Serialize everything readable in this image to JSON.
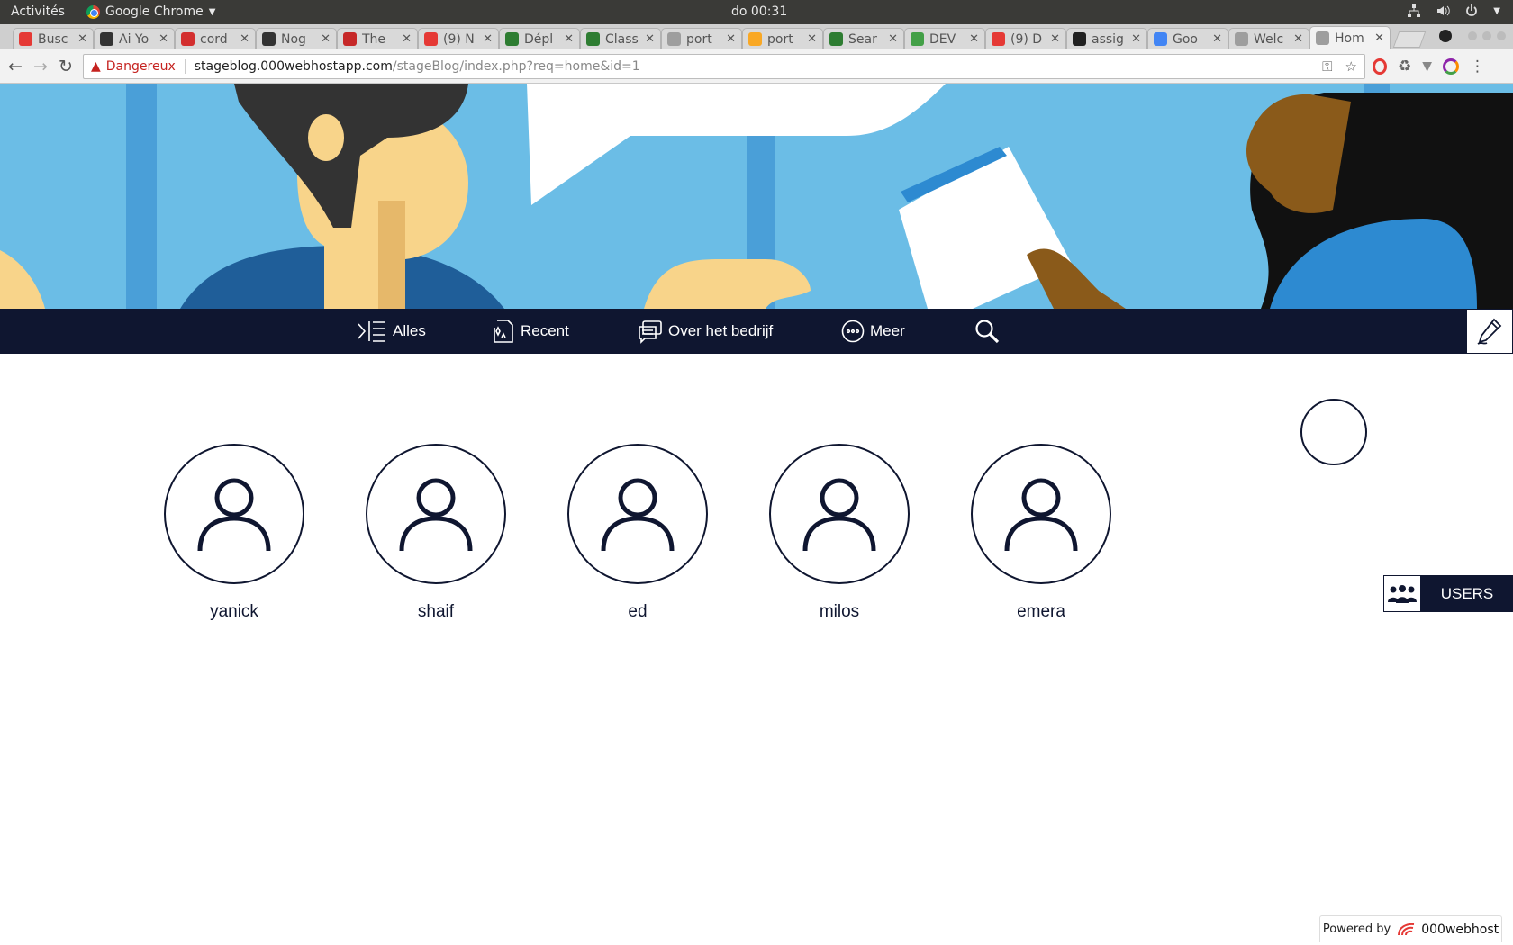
{
  "system_bar": {
    "activities": "Activités",
    "app_name": "Google Chrome",
    "clock": "do 00:31"
  },
  "tabs": [
    {
      "title": "Busc",
      "favicon_color": "#e53935"
    },
    {
      "title": "Ai Yo",
      "favicon_color": "#333333"
    },
    {
      "title": "cord",
      "favicon_color": "#d32f2f"
    },
    {
      "title": "Nog",
      "favicon_color": "#333333"
    },
    {
      "title": "The",
      "favicon_color": "#c62828"
    },
    {
      "title": "(9) N",
      "favicon_color": "#e53935"
    },
    {
      "title": "Dépl",
      "favicon_color": "#2e7d32"
    },
    {
      "title": "Class",
      "favicon_color": "#2e7d32"
    },
    {
      "title": "port",
      "favicon_color": "#9e9e9e"
    },
    {
      "title": "port",
      "favicon_color": "#f9a825"
    },
    {
      "title": "Sear",
      "favicon_color": "#2e7d32"
    },
    {
      "title": "DEV",
      "favicon_color": "#43a047"
    },
    {
      "title": "(9) D",
      "favicon_color": "#e53935"
    },
    {
      "title": "assig",
      "favicon_color": "#212121"
    },
    {
      "title": "Goo",
      "favicon_color": "#4285f4"
    },
    {
      "title": "Welc",
      "favicon_color": "#9e9e9e"
    },
    {
      "title": "Hom",
      "favicon_color": "#9e9e9e",
      "active": true
    }
  ],
  "address_bar": {
    "security_label": "Dangereux",
    "url_host": "stageblog.000webhostapp.com",
    "url_path": "/stageBlog/index.php?req=home&id=1"
  },
  "menu": {
    "items": [
      {
        "label": "Alles",
        "icon": "indent-list-icon"
      },
      {
        "label": "Recent",
        "icon": "document-sparkle-icon"
      },
      {
        "label": "Over het bedrijf",
        "icon": "chat-bubbles-icon"
      },
      {
        "label": "Meer",
        "icon": "more-dots-icon"
      }
    ],
    "search_icon": "search-icon",
    "edit_icon": "pencil-icon"
  },
  "users": [
    {
      "name": "yanick"
    },
    {
      "name": "shaif"
    },
    {
      "name": "ed"
    },
    {
      "name": "milos"
    },
    {
      "name": "emera"
    }
  ],
  "users_tab": {
    "label": "USERS",
    "icon": "group-icon"
  },
  "footer": {
    "powered_by": "Powered by",
    "brand": "000webhost"
  },
  "colors": {
    "navy": "#0f1630",
    "banner_blue": "#6bbde6"
  }
}
